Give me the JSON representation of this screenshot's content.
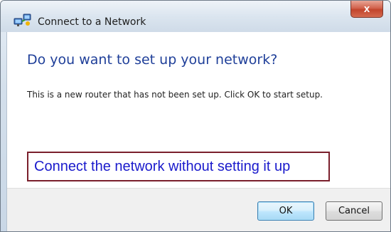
{
  "window": {
    "title": "Connect to a Network",
    "close_label": "x"
  },
  "dialog": {
    "heading": "Do you want to set up your network?",
    "message": "This is a new router that has not been set up. Click OK to start setup.",
    "connect_link": "Connect the network without setting it up"
  },
  "buttons": {
    "ok": "OK",
    "cancel": "Cancel"
  },
  "colors": {
    "heading": "#1f3f99",
    "link": "#1a1acc",
    "highlight_border": "#7a1f2c",
    "close_button": "#c2452d"
  },
  "icons": {
    "title": "network-icon",
    "close": "close-icon"
  }
}
